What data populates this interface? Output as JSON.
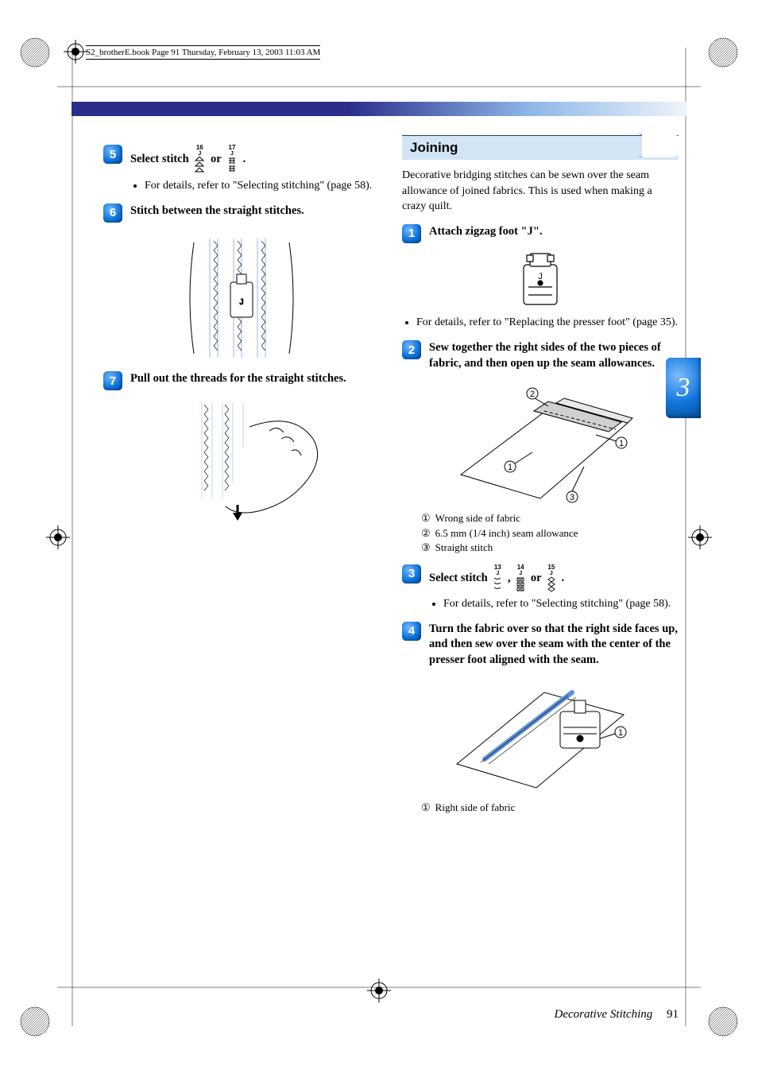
{
  "header": {
    "bookinfo": "S2_brotherE.book  Page 91  Thursday, February 13, 2003  11:03 AM"
  },
  "accent": {},
  "left_column": {
    "step5": {
      "num": "5",
      "prefix": "Select stitch ",
      "or": "or",
      "suffix": ".",
      "stitch_a_num": "16",
      "stitch_a_j": "J",
      "stitch_b_num": "17",
      "stitch_b_j": "J",
      "detail": "For details, refer to \"Selecting stitching\" (page 58)."
    },
    "step6": {
      "num": "6",
      "title": "Stitch between the straight stitches."
    },
    "step7": {
      "num": "7",
      "title": "Pull out the threads for the straight stitches."
    }
  },
  "right_column": {
    "section_title": "Joining",
    "intro": "Decorative bridging stitches can be sewn over the seam allowance of joined fabrics. This is used when making a crazy quilt.",
    "step1": {
      "num": "1",
      "title": "Attach zigzag foot \"J\".",
      "foot_label": "J",
      "detail": "For details, refer to \"Replacing the presser foot\" (page 35)."
    },
    "step2": {
      "num": "2",
      "title": "Sew together the right sides of the two pieces of fabric, and then open up the seam allowances.",
      "callouts": {
        "c1n": "①",
        "c1": "Wrong side of fabric",
        "c2n": "②",
        "c2": "6.5 mm (1/4 inch) seam allowance",
        "c3n": "③",
        "c3": "Straight stitch"
      }
    },
    "step3": {
      "num": "3",
      "prefix": "Select stitch ",
      "comma": ",",
      "or": "or",
      "suffix": ".",
      "stitch_a_num": "13",
      "stitch_a_j": "J",
      "stitch_b_num": "14",
      "stitch_b_j": "J",
      "stitch_c_num": "15",
      "stitch_c_j": "J",
      "detail": "For details, refer to \"Selecting stitching\" (page 58)."
    },
    "step4": {
      "num": "4",
      "title": "Turn the fabric over so that the right side faces up, and then sew over the seam with the center of the presser foot aligned with the seam.",
      "callouts": {
        "c1n": "①",
        "c1": "Right side of fabric"
      }
    }
  },
  "chapter_tab": "3",
  "footer": {
    "title": "Decorative Stitching",
    "page": "91"
  }
}
